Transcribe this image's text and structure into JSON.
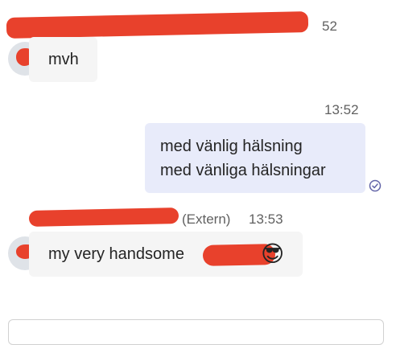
{
  "messages": [
    {
      "direction": "incoming",
      "sender_suffix": "",
      "time": "52",
      "text": "mvh"
    },
    {
      "direction": "outgoing",
      "time": "13:52",
      "lines": [
        "med vänlig hälsning",
        "med vänliga hälsningar"
      ],
      "status_icon": "read-receipt-check-icon"
    },
    {
      "direction": "incoming",
      "sender_suffix": "(Extern)",
      "time": "13:53",
      "text_visible": "my very handsome",
      "emoji": "😎"
    }
  ],
  "colors": {
    "outgoing_bubble": "#e8ebfa",
    "incoming_bubble": "#f5f5f5",
    "accent": "#6264a7",
    "presence_busy": "#c4314b"
  }
}
